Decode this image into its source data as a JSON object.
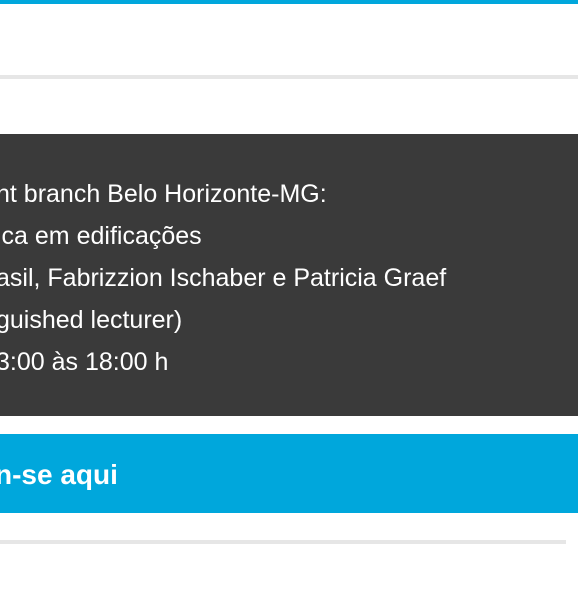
{
  "colors": {
    "accent": "#00a7dc",
    "panel_background": "#3a3a3a",
    "divider": "#e6e6e6",
    "text_on_dark": "#ffffff"
  },
  "event_info": {
    "lines": [
      "nt branch Belo Horizonte-MG:",
      "ica em edificações",
      "asil, Fabrizzion Ischaber e Patricia Graef",
      "guished lecturer)",
      "3:00 às 18:00 h"
    ]
  },
  "cta": {
    "label": "n-se aqui"
  }
}
